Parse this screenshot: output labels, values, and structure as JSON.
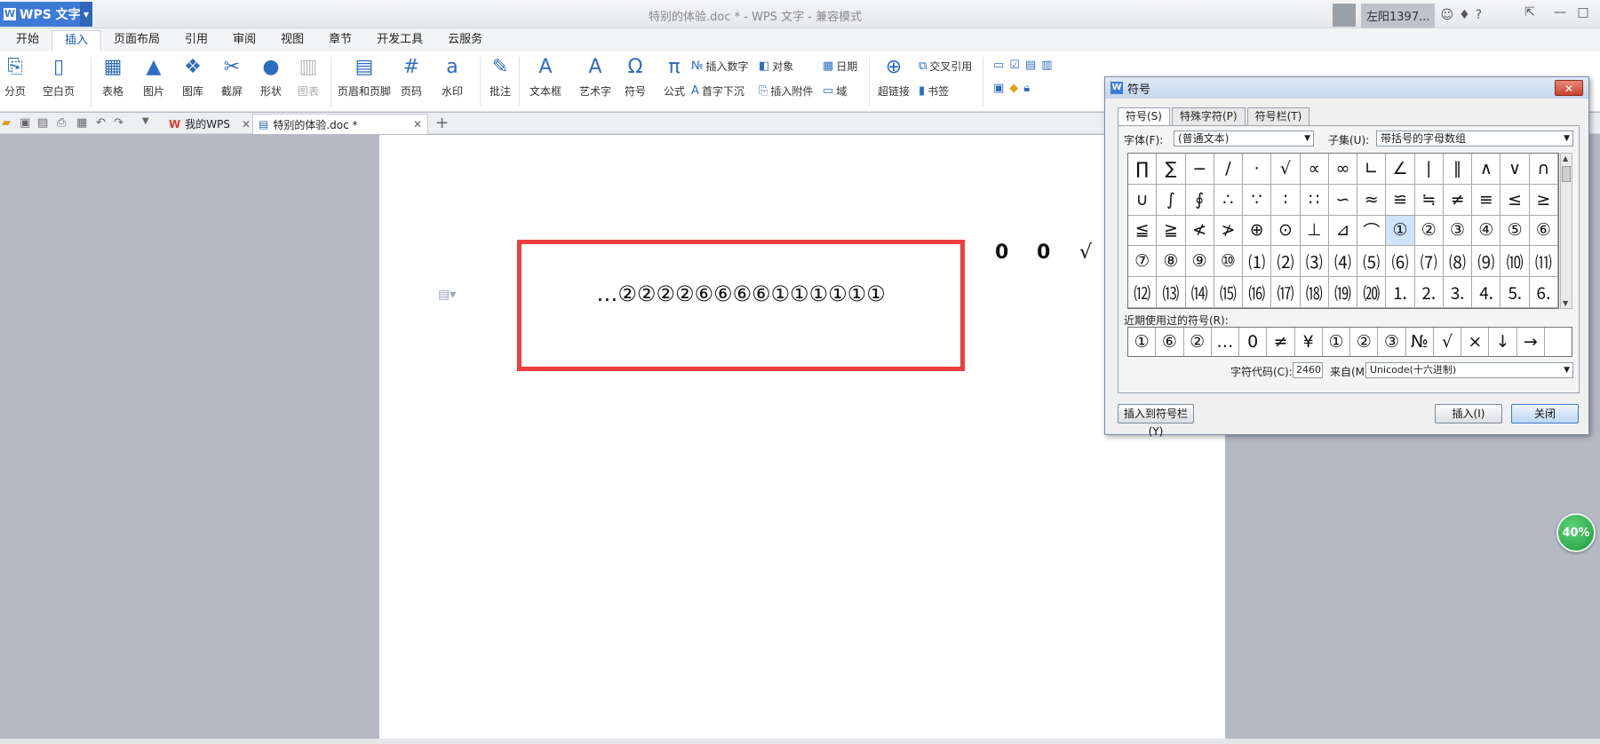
{
  "app": {
    "button_label": "WPS 文字",
    "window_title": "特别的体验.doc * - WPS 文字 - 兼容模式",
    "user_name": "左阳1397..."
  },
  "menu": {
    "tabs": [
      "开始",
      "插入",
      "页面布局",
      "引用",
      "审阅",
      "视图",
      "章节",
      "开发工具",
      "云服务"
    ],
    "active_tab": "插入"
  },
  "ribbon": {
    "page_break": "分页",
    "blank_page": "空白页",
    "table": "表格",
    "picture": "图片",
    "gallery": "图库",
    "screenshot": "截屏",
    "shape": "形状",
    "chart": "图表",
    "header_footer": "页眉和页脚",
    "page_number": "页码",
    "watermark": "水印",
    "comment": "批注",
    "textbox": "文本框",
    "wordart": "艺术字",
    "symbol": "符号",
    "formula": "公式",
    "insert_number": "插入数字",
    "object": "对象",
    "date": "日期",
    "drop_cap": "首字下沉",
    "attachment": "插入附件",
    "field": "域",
    "hyperlink": "超链接",
    "cross_ref": "交叉引用",
    "bookmark": "书签"
  },
  "doc_tabs": {
    "home_tab": "我的WPS",
    "doc_tab": "特别的体验.doc *"
  },
  "document": {
    "content": "…②②②②⑥⑥⑥⑥①①①①①①",
    "side_symbols": [
      "0",
      "0",
      "√"
    ]
  },
  "badge": {
    "value": "40%"
  },
  "dialog": {
    "title": "符号",
    "close_glyph": "✕",
    "tabs": [
      "符号(S)",
      "特殊字符(P)",
      "符号栏(T)"
    ],
    "active_tab": "符号(S)",
    "font_label": "字体(F):",
    "font_value": "(普通文本)",
    "subset_label": "子集(U):",
    "subset_value": "带括号的字母数组",
    "grid": [
      [
        "∏",
        "∑",
        "−",
        "∕",
        "·",
        "√",
        "∝",
        "∞",
        "∟",
        "∠",
        "∣",
        "∥",
        "∧",
        "∨",
        "∩"
      ],
      [
        "∪",
        "∫",
        "∮",
        "∴",
        "∵",
        "∶",
        "∷",
        "∽",
        "≈",
        "≌",
        "≒",
        "≠",
        "≡",
        "≤",
        "≥"
      ],
      [
        "≦",
        "≧",
        "≮",
        "≯",
        "⊕",
        "⊙",
        "⊥",
        "⊿",
        "⌒",
        "①",
        "②",
        "③",
        "④",
        "⑤",
        "⑥"
      ],
      [
        "⑦",
        "⑧",
        "⑨",
        "⑩",
        "⑴",
        "⑵",
        "⑶",
        "⑷",
        "⑸",
        "⑹",
        "⑺",
        "⑻",
        "⑼",
        "⑽",
        "⑾"
      ],
      [
        "⑿",
        "⒀",
        "⒁",
        "⒂",
        "⒃",
        "⒄",
        "⒅",
        "⒆",
        "⒇",
        "⒈",
        "⒉",
        "⒊",
        "⒋",
        "⒌",
        "⒍"
      ]
    ],
    "selected_symbol": "①",
    "recent_label": "近期使用过的符号(R):",
    "recent": [
      "①",
      "⑥",
      "②",
      "…",
      "0",
      "≠",
      "¥",
      "①",
      "②",
      "③",
      "№",
      "√",
      "×",
      "↓",
      "→"
    ],
    "code_label": "字符代码(C):",
    "code_value": "2460",
    "from_label": "来自(M)",
    "from_value": "Unicode(十六进制)",
    "insert_to_bar": "插入到符号栏(Y)",
    "insert": "插入(I)",
    "close": "关闭"
  }
}
